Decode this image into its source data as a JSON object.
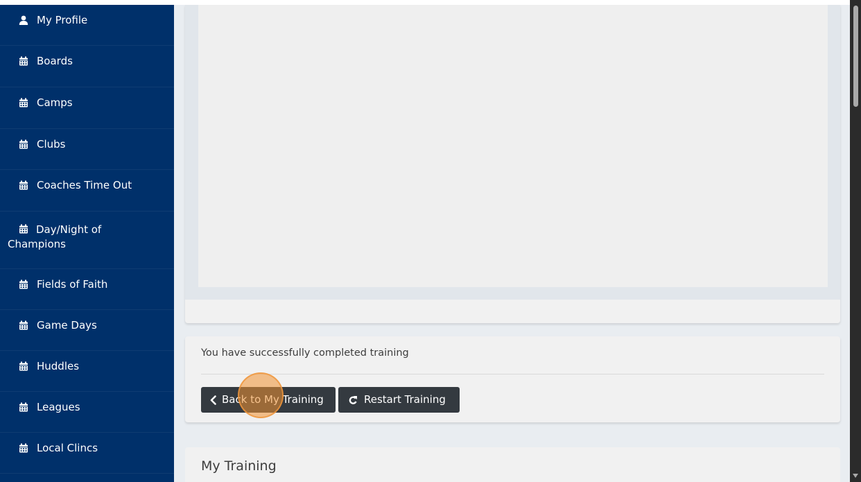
{
  "sidebar": {
    "items": [
      {
        "label": "My Profile",
        "icon": "user-icon"
      },
      {
        "label": "Boards",
        "icon": "calendar-icon"
      },
      {
        "label": "Camps",
        "icon": "calendar-icon"
      },
      {
        "label": "Clubs",
        "icon": "calendar-icon"
      },
      {
        "label": "Coaches Time Out",
        "icon": "calendar-icon"
      },
      {
        "label_line1": "Day/Night of",
        "label_line2": "Champions",
        "icon": "calendar-icon"
      },
      {
        "label": "Fields of Faith",
        "icon": "calendar-icon"
      },
      {
        "label": "Game Days",
        "icon": "calendar-icon"
      },
      {
        "label": "Huddles",
        "icon": "calendar-icon"
      },
      {
        "label": "Leagues",
        "icon": "calendar-icon"
      },
      {
        "label": "Local Clincs",
        "icon": "calendar-icon"
      }
    ],
    "colors": {
      "background": "#00306a",
      "text": "#ffffff"
    }
  },
  "completion": {
    "message": "You have successfully completed training",
    "back_button": {
      "label": "Back to My Training",
      "icon": "chevron-left-icon"
    },
    "restart_button": {
      "label": "Restart Training",
      "icon": "redo-icon"
    }
  },
  "training_section": {
    "title": "My Training"
  },
  "colors": {
    "button_bg": "#343a40",
    "main_bg": "#e9edf1",
    "card_bg": "#f1f1f1",
    "click_marker": "#f09132"
  }
}
